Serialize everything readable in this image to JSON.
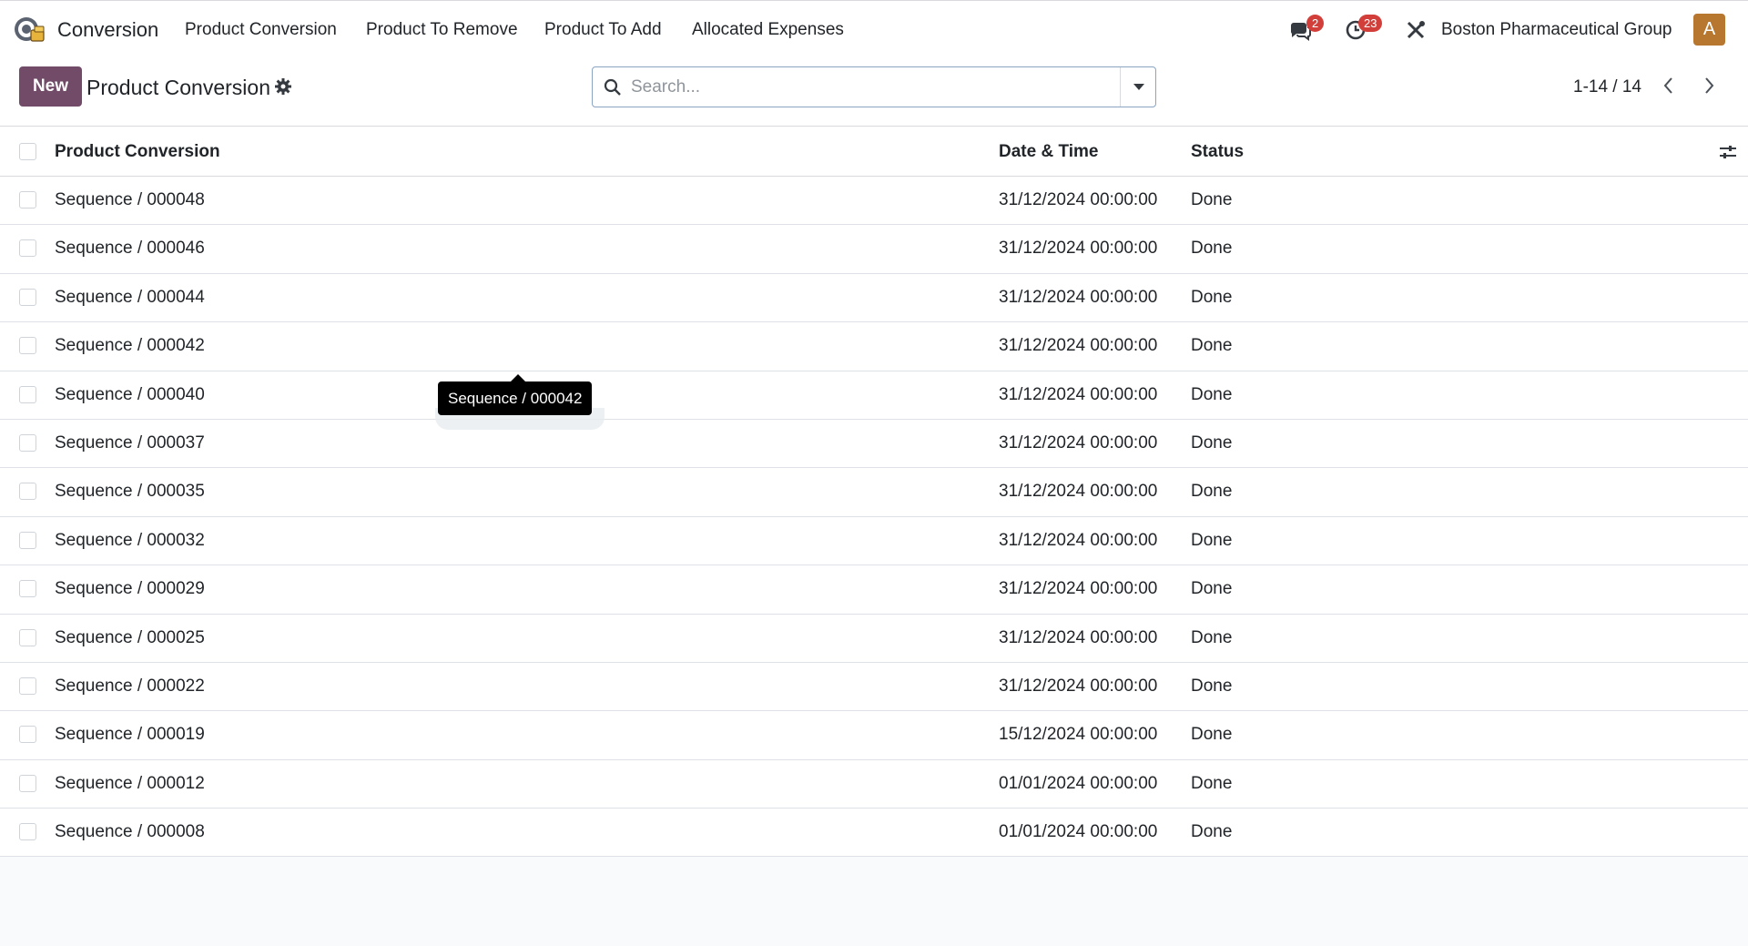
{
  "app": {
    "name": "Conversion",
    "menu": [
      "Product Conversion",
      "Product To Remove",
      "Product To Add",
      "Allocated Expenses"
    ]
  },
  "systray": {
    "messages_count": "2",
    "activities_count": "23",
    "company": "Boston Pharmaceutical Group",
    "avatar_letter": "A"
  },
  "control": {
    "new_label": "New",
    "title": "Product Conversion",
    "search_placeholder": "Search...",
    "pager": "1-14 / 14"
  },
  "table": {
    "headers": {
      "name": "Product Conversion",
      "date": "Date & Time",
      "status": "Status"
    },
    "rows": [
      {
        "name": "Sequence / 000048",
        "date": "31/12/2024 00:00:00",
        "status": "Done"
      },
      {
        "name": "Sequence / 000046",
        "date": "31/12/2024 00:00:00",
        "status": "Done"
      },
      {
        "name": "Sequence / 000044",
        "date": "31/12/2024 00:00:00",
        "status": "Done"
      },
      {
        "name": "Sequence / 000042",
        "date": "31/12/2024 00:00:00",
        "status": "Done"
      },
      {
        "name": "Sequence / 000040",
        "date": "31/12/2024 00:00:00",
        "status": "Done"
      },
      {
        "name": "Sequence / 000037",
        "date": "31/12/2024 00:00:00",
        "status": "Done"
      },
      {
        "name": "Sequence / 000035",
        "date": "31/12/2024 00:00:00",
        "status": "Done"
      },
      {
        "name": "Sequence / 000032",
        "date": "31/12/2024 00:00:00",
        "status": "Done"
      },
      {
        "name": "Sequence / 000029",
        "date": "31/12/2024 00:00:00",
        "status": "Done"
      },
      {
        "name": "Sequence / 000025",
        "date": "31/12/2024 00:00:00",
        "status": "Done"
      },
      {
        "name": "Sequence / 000022",
        "date": "31/12/2024 00:00:00",
        "status": "Done"
      },
      {
        "name": "Sequence / 000019",
        "date": "15/12/2024 00:00:00",
        "status": "Done"
      },
      {
        "name": "Sequence / 000012",
        "date": "01/01/2024 00:00:00",
        "status": "Done"
      },
      {
        "name": "Sequence / 000008",
        "date": "01/01/2024 00:00:00",
        "status": "Done"
      }
    ]
  },
  "tooltip": {
    "text": "Sequence / 000042"
  },
  "colors": {
    "brand": "#714b67",
    "badge": "#d23f3a",
    "avatar": "#b7772f"
  },
  "icons": [
    "app-logo-icon",
    "chat-icon",
    "clock-icon",
    "tools-icon",
    "gear-icon",
    "search-icon",
    "caret-down-icon",
    "chevron-left-icon",
    "chevron-right-icon",
    "sliders-icon"
  ]
}
